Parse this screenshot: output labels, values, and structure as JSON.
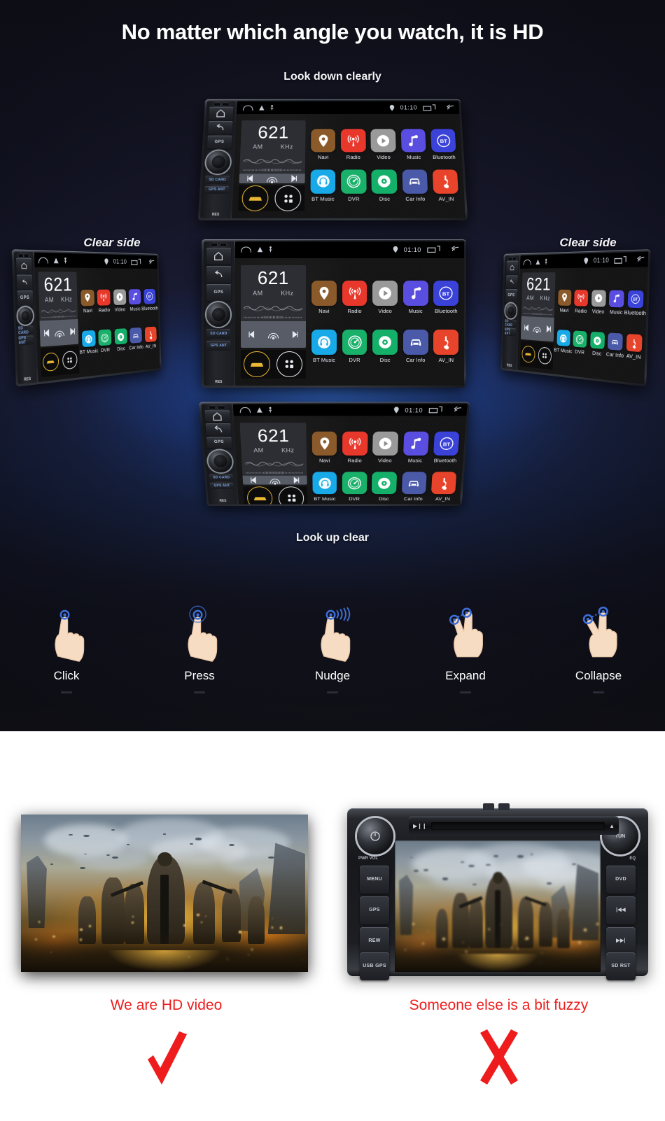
{
  "hero": {
    "title": "No matter which angle you watch, it is HD",
    "caption_top": "Look down clearly",
    "caption_bottom": "Look up clear",
    "caption_left": "Clear side",
    "caption_right": "Clear side",
    "background_color": "#13131f",
    "glow_color": "#3c78e1"
  },
  "device": {
    "side_buttons": [
      {
        "name": "home",
        "label": ""
      },
      {
        "name": "back",
        "label": ""
      },
      {
        "name": "gps",
        "label": "GPS"
      }
    ],
    "slots": [
      {
        "label": "SD CARD"
      },
      {
        "label": "GPS ANT"
      }
    ],
    "reset_label": "RES",
    "statusbar": {
      "time": "01:10"
    },
    "radio": {
      "frequency": "621",
      "band": "AM",
      "unit": "KHz"
    },
    "apps_row1": [
      {
        "label": "Navi",
        "icon": "location-pin-icon",
        "color": "#8a5a2b"
      },
      {
        "label": "Radio",
        "icon": "radio-waves-icon",
        "color": "#e8382c"
      },
      {
        "label": "Video",
        "icon": "play-circle-icon",
        "color": "#9a9a9a"
      },
      {
        "label": "Music",
        "icon": "music-note-icon",
        "color": "#5a4ee0"
      },
      {
        "label": "Bluetooth",
        "icon": "bluetooth-icon",
        "color": "#3a42d8"
      }
    ],
    "apps_row2": [
      {
        "label": "BT Music",
        "icon": "headphone-icon",
        "color": "#18a9e8"
      },
      {
        "label": "DVR",
        "icon": "dashboard-icon",
        "color": "#19b06a"
      },
      {
        "label": "Disc",
        "icon": "disc-icon",
        "color": "#14b06a"
      },
      {
        "label": "Car Info",
        "icon": "car-front-icon",
        "color": "#4a5aa8"
      },
      {
        "label": "AV_IN",
        "icon": "av-input-icon",
        "color": "#e8442c"
      }
    ]
  },
  "gestures": [
    {
      "label": "Click",
      "icon": "hand-tap-icon"
    },
    {
      "label": "Press",
      "icon": "hand-press-icon"
    },
    {
      "label": "Nudge",
      "icon": "hand-swipe-icon"
    },
    {
      "label": "Expand",
      "icon": "hand-pinch-out-icon"
    },
    {
      "label": "Collapse",
      "icon": "hand-pinch-in-icon"
    }
  ],
  "compare": {
    "left": {
      "caption": "We are HD video",
      "mark": "check-mark-icon",
      "mark_color": "#ee1c1c"
    },
    "right": {
      "caption": "Someone else is a bit fuzzy",
      "mark": "cross-mark-icon",
      "mark_color": "#ee1c1c"
    },
    "vw_unit": {
      "left_buttons": [
        "MENU",
        "GPS",
        "REW",
        "USB GPS"
      ],
      "right_buttons": [
        "DVD",
        "|◀◀",
        "▶▶|",
        "SD RST"
      ],
      "power_label": "PWR VOL",
      "tune_label": "TUN",
      "eq_label": "EQ"
    }
  }
}
